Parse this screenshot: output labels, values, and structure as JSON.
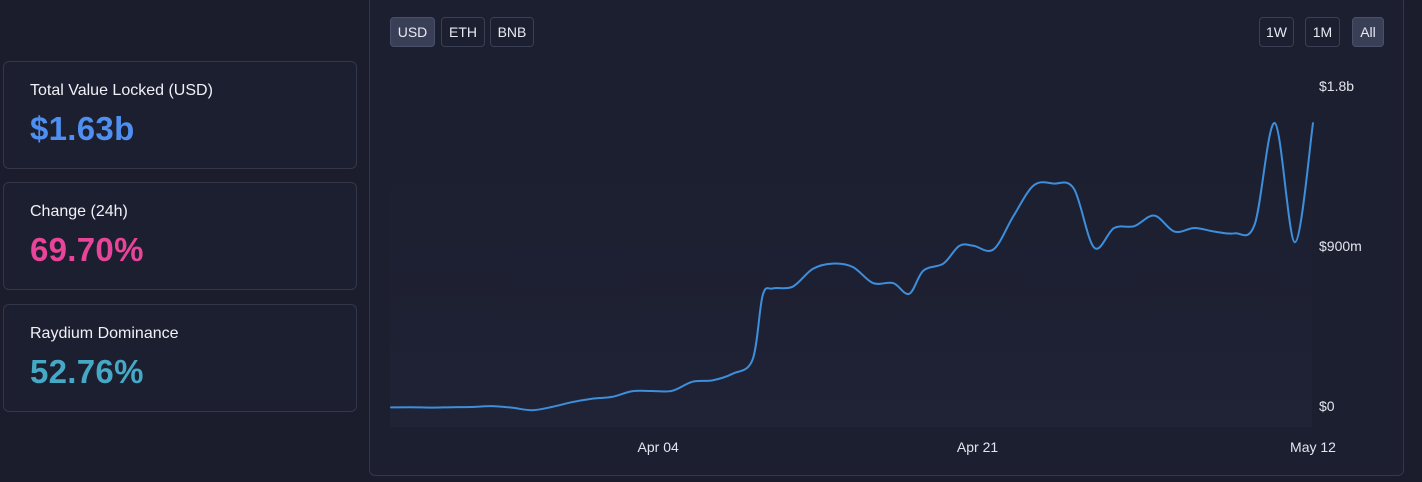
{
  "stats": [
    {
      "label": "Total Value Locked (USD)",
      "value": "$1.63b",
      "color": "#4f8ff0"
    },
    {
      "label": "Change (24h)",
      "value": "69.70%",
      "color": "#e8449a"
    },
    {
      "label": "Raydium Dominance",
      "value": "52.76%",
      "color": "#45a9c6"
    }
  ],
  "currency_buttons": [
    {
      "label": "USD",
      "active": true
    },
    {
      "label": "ETH",
      "active": false
    },
    {
      "label": "BNB",
      "active": false
    }
  ],
  "range_buttons": [
    {
      "label": "1W",
      "active": false
    },
    {
      "label": "1M",
      "active": false
    },
    {
      "label": "All",
      "active": true
    }
  ],
  "chart_data": {
    "type": "line",
    "series": [
      {
        "color": "#3d8edb",
        "points": [
          [
            0,
            0.071
          ],
          [
            1,
            0.072
          ],
          [
            2,
            0.07
          ],
          [
            3,
            0.072
          ],
          [
            4,
            0.073
          ],
          [
            5,
            0.078
          ],
          [
            6,
            0.07
          ],
          [
            7,
            0.055
          ],
          [
            8,
            0.073
          ],
          [
            9,
            0.1
          ],
          [
            10,
            0.12
          ],
          [
            11,
            0.13
          ],
          [
            12,
            0.162
          ],
          [
            13,
            0.163
          ],
          [
            14,
            0.164
          ],
          [
            15,
            0.215
          ],
          [
            16,
            0.223
          ],
          [
            17,
            0.26
          ],
          [
            18,
            0.34
          ],
          [
            18.5,
            0.7
          ],
          [
            19,
            0.74
          ],
          [
            20,
            0.75
          ],
          [
            21,
            0.85
          ],
          [
            22,
            0.88
          ],
          [
            23,
            0.86
          ],
          [
            24,
            0.77
          ],
          [
            25,
            0.77
          ],
          [
            25.8,
            0.71
          ],
          [
            26.5,
            0.84
          ],
          [
            27.5,
            0.88
          ],
          [
            28.3,
            0.98
          ],
          [
            29,
            0.98
          ],
          [
            30,
            0.96
          ],
          [
            31,
            1.15
          ],
          [
            32,
            1.32
          ],
          [
            33,
            1.33
          ],
          [
            34,
            1.3
          ],
          [
            35,
            0.97
          ],
          [
            36,
            1.08
          ],
          [
            37,
            1.09
          ],
          [
            38,
            1.15
          ],
          [
            39,
            1.06
          ],
          [
            40,
            1.08
          ],
          [
            41,
            1.06
          ],
          [
            42,
            1.05
          ],
          [
            43,
            1.1
          ],
          [
            44,
            1.67
          ],
          [
            45,
            1.0
          ],
          [
            45.9,
            1.67
          ]
        ]
      }
    ],
    "x_ticks": [
      {
        "x": 13.3,
        "label": "Apr 04"
      },
      {
        "x": 29.2,
        "label": "Apr 21"
      },
      {
        "x": 45.9,
        "label": "May 12"
      }
    ],
    "y_ticks": [
      {
        "y": 1.8,
        "label": "$1.8b"
      },
      {
        "y": 0.9,
        "label": "$900m"
      },
      {
        "y": 0,
        "label": "$0"
      }
    ],
    "xlim": [
      0,
      45.9
    ],
    "ylim": [
      0,
      1.8
    ],
    "grid": false
  }
}
